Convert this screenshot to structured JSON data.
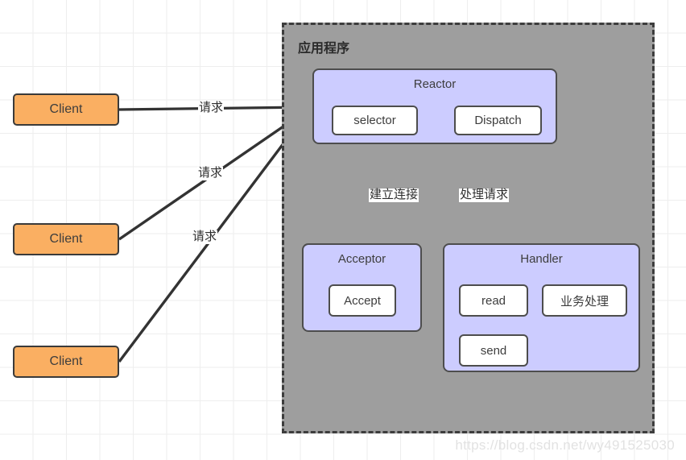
{
  "diagram": {
    "title": "应用程序",
    "watermark": "https://blog.csdn.net/wy491525030"
  },
  "clients": [
    {
      "label": "Client"
    },
    {
      "label": "Client"
    },
    {
      "label": "Client"
    }
  ],
  "request_labels": [
    {
      "label": "请求"
    },
    {
      "label": "请求"
    },
    {
      "label": "请求"
    }
  ],
  "reactor": {
    "title": "Reactor",
    "items": [
      {
        "label": "selector"
      },
      {
        "label": "Dispatch"
      }
    ]
  },
  "acceptor": {
    "title": "Acceptor",
    "items": [
      {
        "label": "Accept"
      }
    ]
  },
  "handler": {
    "title": "Handler",
    "items": [
      {
        "label": "read"
      },
      {
        "label": "业务处理"
      },
      {
        "label": "send"
      }
    ]
  },
  "internal_edges": [
    {
      "label": "建立连接"
    },
    {
      "label": "处理请求"
    }
  ],
  "colors": {
    "client_fill": "#faaf62",
    "group_fill": "#ccccff",
    "container_fill": "#9e9e9e",
    "leaf_fill": "#ffffff",
    "stroke": "#4d4d4d",
    "edge_stroke": "#333333"
  }
}
